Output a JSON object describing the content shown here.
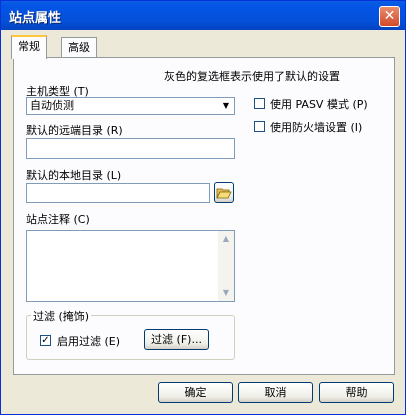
{
  "window": {
    "title": "站点属性",
    "close_glyph": "✕"
  },
  "tabs": [
    {
      "label": "常规",
      "active": true
    },
    {
      "label": "高级",
      "active": false
    }
  ],
  "general": {
    "hint": "灰色的复选框表示使用了默认的设置",
    "host_type_label": "主机类型 (T)",
    "host_type_value": "自动侦测",
    "remote_dir_label": "默认的远端目录 (R)",
    "remote_dir_value": "",
    "local_dir_label": "默认的本地目录 (L)",
    "local_dir_value": "",
    "comment_label": "站点注释 (C)",
    "comment_value": "",
    "pasv_label": "使用 PASV 模式 (P)",
    "pasv_checked": false,
    "firewall_label": "使用防火墙设置 (I)",
    "firewall_checked": false
  },
  "filter": {
    "group_label": "过滤 (掩饰)",
    "enable_label": "启用过滤 (E)",
    "enable_checked": true,
    "filter_button_label": "过滤 (F)..."
  },
  "footer": {
    "ok_label": "确定",
    "cancel_label": "取消",
    "help_label": "帮助"
  },
  "icons": {
    "folder": "folder-open-icon",
    "dropdown": "chevron-down-icon"
  }
}
